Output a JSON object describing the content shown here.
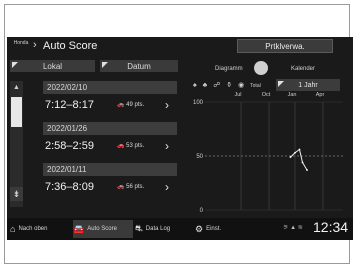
{
  "header": {
    "logo_text": "Honda",
    "title": "Auto Score",
    "practical_button": "Prtklverwa."
  },
  "sort": {
    "lokal": "Lokal",
    "datum": "Datum"
  },
  "view": {
    "diagramm": "Diagramm",
    "kalender": "Kalender",
    "total": "Total",
    "period": "1 Jahr"
  },
  "list": [
    {
      "date": "2022/02/10",
      "time": "7:12–8:17",
      "points": "49 pts."
    },
    {
      "date": "2022/01/26",
      "time": "2:58–2:59",
      "points": "53 pts."
    },
    {
      "date": "2022/01/11",
      "time": "7:36–8:09",
      "points": "56 pts."
    }
  ],
  "chart_data": {
    "type": "line",
    "y_ticks": [
      "100",
      "50",
      "0"
    ],
    "x_labels": [
      "Jul",
      "Oct",
      "2022\nJan",
      "Apr"
    ],
    "ylim": [
      0,
      100
    ],
    "x": [
      3.5,
      3.8,
      4.1,
      4.3,
      4.6
    ],
    "values": [
      49,
      53,
      56,
      44,
      37
    ]
  },
  "bottom": {
    "nach_oben": "Nach oben",
    "auto_score": "Auto Score",
    "data_log": "Data Log",
    "einst": "Einst.",
    "clock": "12:34"
  },
  "colors": {
    "screen_bg": "#1a1a1a",
    "row_bg": "#3d3d3d",
    "accent": "#e8e8e8"
  }
}
